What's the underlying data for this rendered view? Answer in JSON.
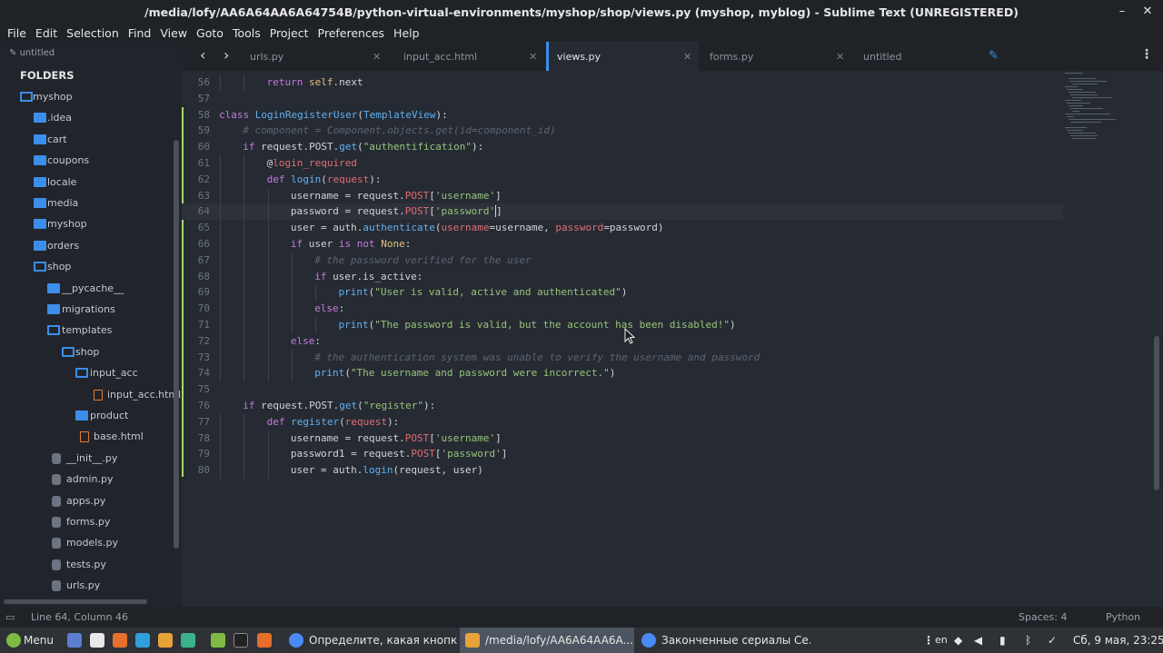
{
  "window": {
    "title": "/media/lofy/AA6A64AA6A64754B/python-virtual-environments/myshop/shop/views.py (myshop, myblog) - Sublime Text (UNREGISTERED)",
    "minimize": "–",
    "close": "✕"
  },
  "menu": [
    "File",
    "Edit",
    "Selection",
    "Find",
    "View",
    "Goto",
    "Tools",
    "Project",
    "Preferences",
    "Help"
  ],
  "sidebar": {
    "open_file": "untitled",
    "header": "FOLDERS",
    "items": [
      {
        "label": "myshop",
        "icon": "folder-open-icon"
      },
      {
        "label": ".idea",
        "icon": "folder-icon"
      },
      {
        "label": "cart",
        "icon": "folder-icon"
      },
      {
        "label": "coupons",
        "icon": "folder-icon"
      },
      {
        "label": "locale",
        "icon": "folder-icon"
      },
      {
        "label": "media",
        "icon": "folder-icon"
      },
      {
        "label": "myshop",
        "icon": "folder-icon"
      },
      {
        "label": "orders",
        "icon": "folder-icon"
      },
      {
        "label": "shop",
        "icon": "folder-open-icon"
      },
      {
        "label": "__pycache__",
        "icon": "folder-icon"
      },
      {
        "label": "migrations",
        "icon": "folder-icon"
      },
      {
        "label": "templates",
        "icon": "folder-open-icon"
      },
      {
        "label": "shop",
        "icon": "folder-open-icon"
      },
      {
        "label": "input_acc",
        "icon": "folder-open-icon"
      },
      {
        "label": "input_acc.html",
        "icon": "html-file-icon"
      },
      {
        "label": "product",
        "icon": "folder-icon"
      },
      {
        "label": "base.html",
        "icon": "html-file-icon"
      },
      {
        "label": "__init__.py",
        "icon": "python-file-icon"
      },
      {
        "label": "admin.py",
        "icon": "python-file-icon"
      },
      {
        "label": "apps.py",
        "icon": "python-file-icon"
      },
      {
        "label": "forms.py",
        "icon": "python-file-icon"
      },
      {
        "label": "models.py",
        "icon": "python-file-icon"
      },
      {
        "label": "tests.py",
        "icon": "python-file-icon"
      },
      {
        "label": "urls.py",
        "icon": "python-file-icon"
      }
    ]
  },
  "tabs": [
    {
      "label": "urls.py",
      "active": false
    },
    {
      "label": "input_acc.html",
      "active": false
    },
    {
      "label": "views.py",
      "active": true
    },
    {
      "label": "forms.py",
      "active": false
    },
    {
      "label": "untitled",
      "active": false
    }
  ],
  "tab_close": "✕",
  "editor": {
    "lines": [
      {
        "n": "56",
        "indent": 2
      },
      {
        "n": "57",
        "indent": 0
      },
      {
        "n": "58",
        "indent": 0
      },
      {
        "n": "59",
        "indent": 1
      },
      {
        "n": "60",
        "indent": 1
      },
      {
        "n": "61",
        "indent": 2
      },
      {
        "n": "62",
        "indent": 2
      },
      {
        "n": "63",
        "indent": 3
      },
      {
        "n": "64",
        "indent": 3
      },
      {
        "n": "65",
        "indent": 3
      },
      {
        "n": "66",
        "indent": 3
      },
      {
        "n": "67",
        "indent": 4
      },
      {
        "n": "68",
        "indent": 4
      },
      {
        "n": "69",
        "indent": 5
      },
      {
        "n": "70",
        "indent": 4
      },
      {
        "n": "71",
        "indent": 5
      },
      {
        "n": "72",
        "indent": 3
      },
      {
        "n": "73",
        "indent": 4
      },
      {
        "n": "74",
        "indent": 4
      },
      {
        "n": "75",
        "indent": 0
      },
      {
        "n": "76",
        "indent": 1
      },
      {
        "n": "77",
        "indent": 2
      },
      {
        "n": "78",
        "indent": 3
      },
      {
        "n": "79",
        "indent": 3
      },
      {
        "n": "80",
        "indent": 3
      }
    ],
    "code": [
      [
        [
          "kw",
          "return "
        ],
        [
          "sf",
          "self"
        ],
        [
          "pl",
          ".next"
        ]
      ],
      [],
      [
        [
          "kw",
          "class "
        ],
        [
          "fn",
          "LoginRegisterUser"
        ],
        [
          "pl",
          "("
        ],
        [
          "fn",
          "TemplateView"
        ],
        [
          "pl",
          "):"
        ]
      ],
      [
        [
          "cm",
          "# component = Component.objects.get(id=component_id)"
        ]
      ],
      [
        [
          "kw",
          "if "
        ],
        [
          "pl",
          "request.POST."
        ],
        [
          "fn",
          "get"
        ],
        [
          "pl",
          "("
        ],
        [
          "str",
          "\"authentification\""
        ],
        [
          "pl",
          "):"
        ]
      ],
      [
        [
          "pl",
          "@"
        ],
        [
          "at",
          "login_required"
        ]
      ],
      [
        [
          "kw",
          "def "
        ],
        [
          "fn",
          "login"
        ],
        [
          "pl",
          "("
        ],
        [
          "at",
          "request"
        ],
        [
          "pl",
          "):"
        ]
      ],
      [
        [
          "pl",
          "username = request."
        ],
        [
          "at",
          "POST"
        ],
        [
          "pl",
          "["
        ],
        [
          "str",
          "'username'"
        ],
        [
          "pl",
          "]"
        ]
      ],
      [
        [
          "pl",
          "password = request."
        ],
        [
          "at",
          "POST"
        ],
        [
          "pl",
          "["
        ],
        [
          "str",
          "'password'"
        ],
        [
          "cursor",
          ""
        ],
        [
          "pl",
          "]"
        ]
      ],
      [
        [
          "pl",
          "user = auth."
        ],
        [
          "fn",
          "authenticate"
        ],
        [
          "pl",
          "("
        ],
        [
          "at",
          "username"
        ],
        [
          "pl",
          "=username, "
        ],
        [
          "at",
          "password"
        ],
        [
          "pl",
          "=password)"
        ]
      ],
      [
        [
          "kw",
          "if "
        ],
        [
          "pl",
          "user "
        ],
        [
          "kw",
          "is not "
        ],
        [
          "sf",
          "None"
        ],
        [
          "pl",
          ":"
        ]
      ],
      [
        [
          "cm",
          "# the password verified for the user"
        ]
      ],
      [
        [
          "kw",
          "if "
        ],
        [
          "pl",
          "user.is_active:"
        ]
      ],
      [
        [
          "fn",
          "print"
        ],
        [
          "pl",
          "("
        ],
        [
          "str",
          "\"User is valid, active and authenticated\""
        ],
        [
          "pl",
          ")"
        ]
      ],
      [
        [
          "kw",
          "else"
        ],
        [
          "pl",
          ":"
        ]
      ],
      [
        [
          "fn",
          "print"
        ],
        [
          "pl",
          "("
        ],
        [
          "str",
          "\"The password is valid, but the account has been disabled!\""
        ],
        [
          "pl",
          ")"
        ]
      ],
      [
        [
          "kw",
          "else"
        ],
        [
          "pl",
          ":"
        ]
      ],
      [
        [
          "cm",
          "# the authentication system was unable to verify the username and password"
        ]
      ],
      [
        [
          "fn",
          "print"
        ],
        [
          "pl",
          "("
        ],
        [
          "str",
          "\"The username and password were incorrect.\""
        ],
        [
          "pl",
          ")"
        ]
      ],
      [],
      [
        [
          "kw",
          "if "
        ],
        [
          "pl",
          "request.POST."
        ],
        [
          "fn",
          "get"
        ],
        [
          "pl",
          "("
        ],
        [
          "str",
          "\"register\""
        ],
        [
          "pl",
          "):"
        ]
      ],
      [
        [
          "kw",
          "def "
        ],
        [
          "fn",
          "register"
        ],
        [
          "pl",
          "("
        ],
        [
          "at",
          "request"
        ],
        [
          "pl",
          "):"
        ]
      ],
      [
        [
          "pl",
          "username = request."
        ],
        [
          "at",
          "POST"
        ],
        [
          "pl",
          "["
        ],
        [
          "str",
          "'username'"
        ],
        [
          "pl",
          "]"
        ]
      ],
      [
        [
          "pl",
          "password1 = request."
        ],
        [
          "at",
          "POST"
        ],
        [
          "pl",
          "["
        ],
        [
          "str",
          "'password'"
        ],
        [
          "pl",
          "]"
        ]
      ],
      [
        [
          "pl",
          "user = auth."
        ],
        [
          "fn",
          "login"
        ],
        [
          "pl",
          "(request, user)"
        ]
      ]
    ]
  },
  "status": {
    "position": "Line 64, Column 46",
    "spaces": "Spaces: 4",
    "syntax": "Python"
  },
  "taskbar": {
    "menu": "Menu",
    "windows": [
      {
        "label": "Определите, какая кнопк...",
        "active": false
      },
      {
        "label": "/media/lofy/AA6A64AA6A...",
        "active": true
      },
      {
        "label": "Законченные сериалы Се...",
        "active": false
      }
    ],
    "lang": "en",
    "clock": "Сб, 9 мая, 23:25"
  },
  "colors": {
    "accent": "#3b8eea",
    "modified_marker": "#a6d86c"
  }
}
